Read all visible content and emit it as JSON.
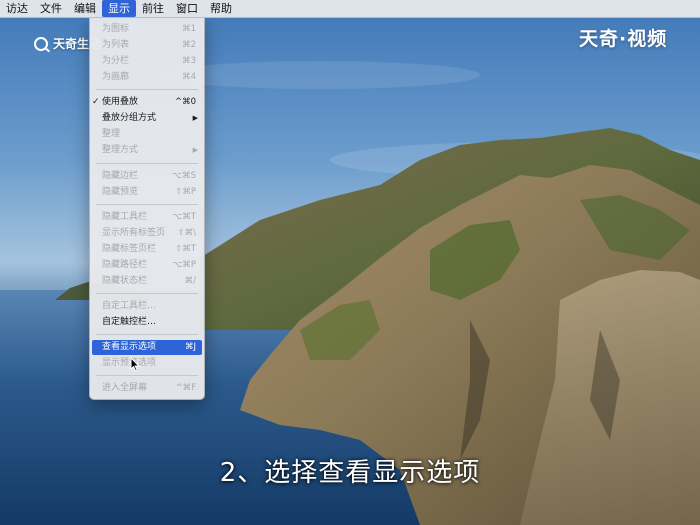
{
  "menubar": {
    "items": [
      "访达",
      "文件",
      "编辑",
      "显示",
      "前往",
      "窗口",
      "帮助"
    ],
    "active_index": 3
  },
  "view_menu": {
    "items": [
      {
        "label": "为图标",
        "shortcut": "⌘1",
        "enabled": false
      },
      {
        "label": "为列表",
        "shortcut": "⌘2",
        "enabled": false
      },
      {
        "label": "为分栏",
        "shortcut": "⌘3",
        "enabled": false
      },
      {
        "label": "为画廊",
        "shortcut": "⌘4",
        "enabled": false
      },
      {
        "label": "使用叠放",
        "shortcut": "^⌘0",
        "enabled": true,
        "checked": true
      },
      {
        "label": "叠放分组方式",
        "shortcut": "",
        "enabled": true,
        "submenu": true
      },
      {
        "label": "整理",
        "shortcut": "",
        "enabled": false
      },
      {
        "label": "整理方式",
        "shortcut": "",
        "enabled": false,
        "submenu": true
      },
      {
        "label": "隐藏边栏",
        "shortcut": "⌥⌘S",
        "enabled": false
      },
      {
        "label": "隐藏预览",
        "shortcut": "⇧⌘P",
        "enabled": false
      },
      {
        "label": "隐藏工具栏",
        "shortcut": "⌥⌘T",
        "enabled": false
      },
      {
        "label": "显示所有标签页",
        "shortcut": "⇧⌘\\",
        "enabled": false
      },
      {
        "label": "隐藏标签页栏",
        "shortcut": "⇧⌘T",
        "enabled": false
      },
      {
        "label": "隐藏路径栏",
        "shortcut": "⌥⌘P",
        "enabled": false
      },
      {
        "label": "隐藏状态栏",
        "shortcut": "⌘/",
        "enabled": false
      },
      {
        "label": "自定工具栏…",
        "shortcut": "",
        "enabled": false
      },
      {
        "label": "自定触控栏…",
        "shortcut": "",
        "enabled": true
      },
      {
        "label": "查看显示选项",
        "shortcut": "⌘J",
        "enabled": true,
        "highlighted": true
      },
      {
        "label": "显示预览选项",
        "shortcut": "",
        "enabled": false
      },
      {
        "label": "进入全屏幕",
        "shortcut": "^⌘F",
        "enabled": false
      }
    ]
  },
  "watermark_left": "天奇生活",
  "watermark_right": "天奇·视频",
  "subtitle": "2、选择查看显示选项",
  "colors": {
    "highlight": "#2f63d8",
    "menu_bg": "#e8e9ec",
    "disabled_text": "#a7a8ac"
  }
}
